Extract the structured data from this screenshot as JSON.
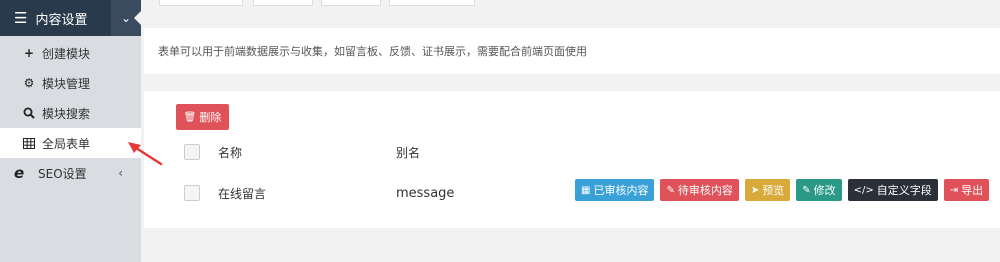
{
  "sidebar": {
    "header": {
      "icon": "menu-icon",
      "label": "内容设置",
      "chevron": "chevron-down-icon"
    },
    "items": [
      {
        "icon": "plus-icon",
        "label": "创建模块"
      },
      {
        "icon": "gears-icon",
        "label": "模块管理"
      },
      {
        "icon": "search-icon",
        "label": "模块搜索"
      },
      {
        "icon": "table-icon",
        "label": "全局表单",
        "active": true
      }
    ],
    "seo": {
      "icon": "ie-icon",
      "label": "SEO设置",
      "arrow": "chevron-left-icon"
    }
  },
  "info": {
    "text": "表单可以用于前端数据展示与收集，如留言板、反馈、证书展示，需要配合前端页面使用"
  },
  "toolbar": {
    "delete_label": "删除",
    "delete_icon": "trash-icon"
  },
  "table": {
    "headers": {
      "name": "名称",
      "alias": "别名"
    },
    "rows": [
      {
        "name": "在线留言",
        "alias": "message"
      }
    ]
  },
  "actions": [
    {
      "label": "已审核内容",
      "icon": "table-icon",
      "color": "#3aa0d8"
    },
    {
      "label": "待审核内容",
      "icon": "edit-icon",
      "color": "#e0525a"
    },
    {
      "label": "预览",
      "icon": "send-icon",
      "color": "#d9a93a"
    },
    {
      "label": "修改",
      "icon": "edit-icon",
      "color": "#2a9a87"
    },
    {
      "label": "自定义字段",
      "icon": "code-icon",
      "color": "#2a2f3a"
    },
    {
      "label": "导出",
      "icon": "export-icon",
      "color": "#e0525a"
    }
  ],
  "colors": {
    "sidebar_header": "#2a3a4d",
    "sidebar_bg": "#d9dce1",
    "arrow": "#e53935"
  }
}
